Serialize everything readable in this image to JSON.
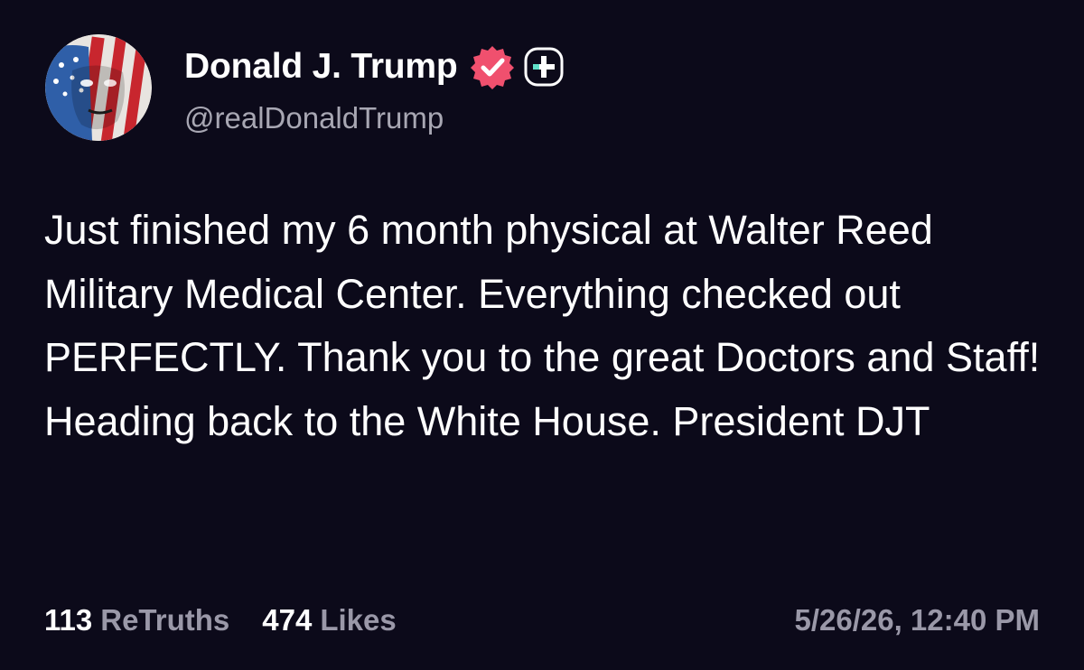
{
  "post": {
    "author": {
      "display_name": "Donald J. Trump",
      "handle": "@realDonaldTrump",
      "verified_icon": "verified-badge-icon",
      "verified_color": "#f0506e",
      "plus_icon": "plus-badge-icon",
      "plus_color": "#5fe0c8"
    },
    "text": "Just finished my 6 month physical at Walter Reed Military Medical Center. Everything checked out PERFECTLY. Thank you to the great Doctors and Staff! Heading back to the White House. President DJT",
    "stats": {
      "retruths_count": "113",
      "retruths_label": "ReTruths",
      "likes_count": "474",
      "likes_label": "Likes"
    },
    "timestamp": "5/26/26, 12:40 PM"
  },
  "colors": {
    "background": "#0c0a1a",
    "text": "#ffffff",
    "muted": "#9a98a8"
  }
}
